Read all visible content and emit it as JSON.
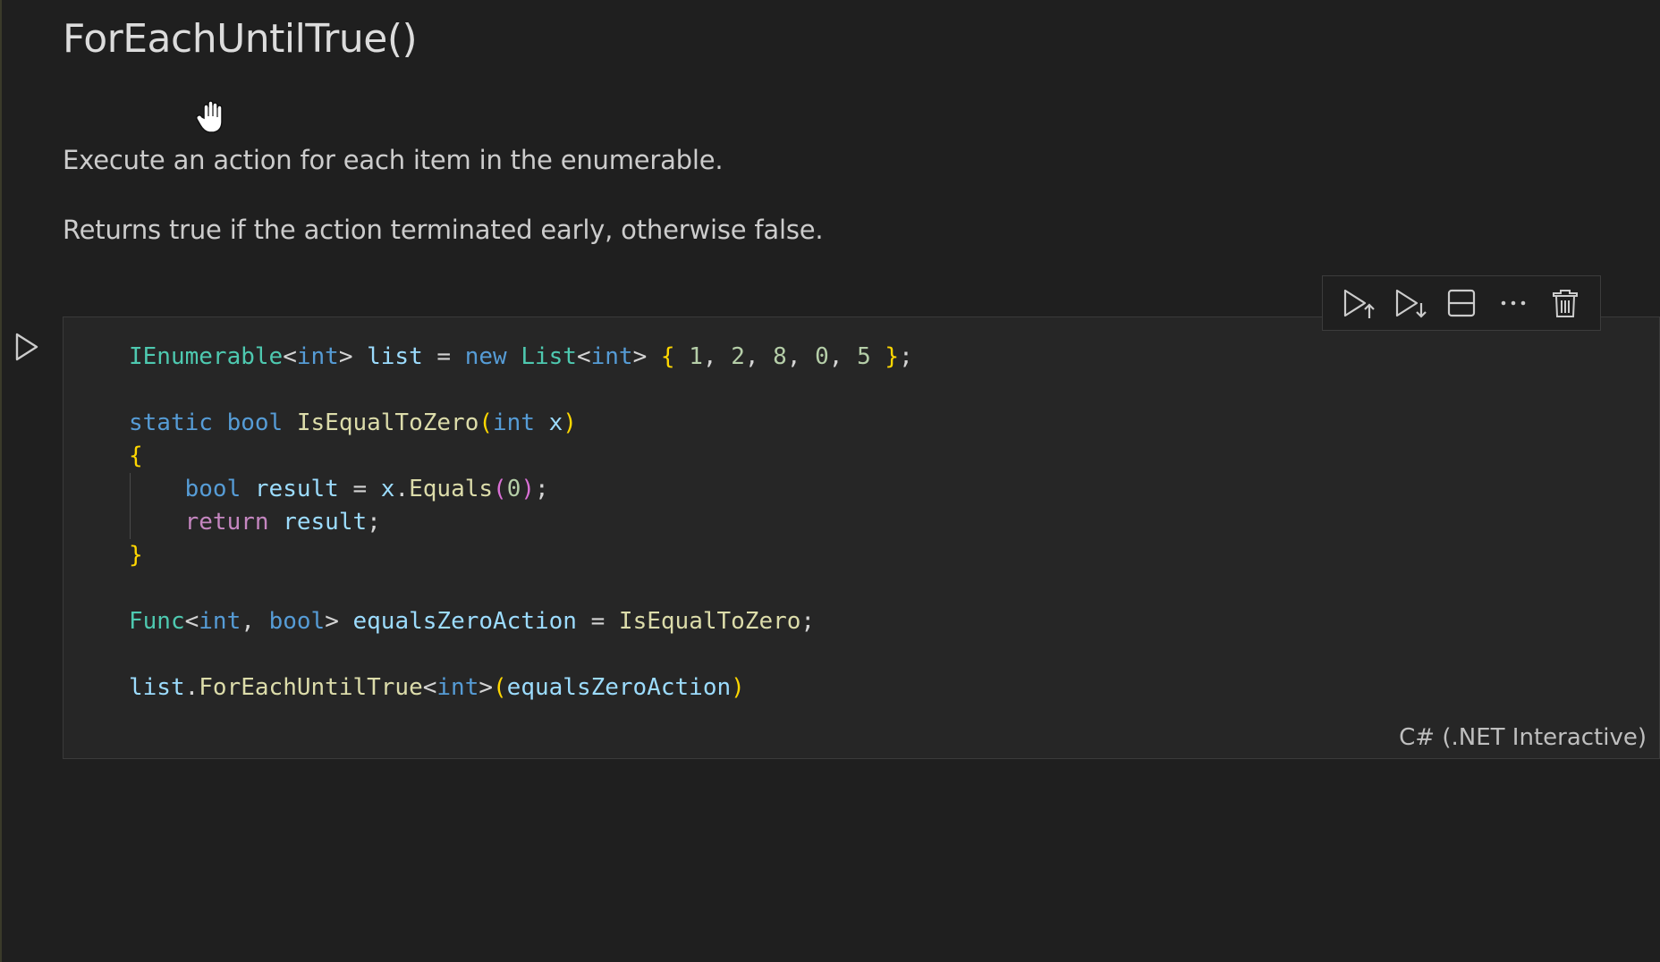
{
  "markdown": {
    "heading": "ForEachUntilTrue()",
    "paragraph1": "Execute an action for each item in the enumerable.",
    "paragraph2": "Returns true if the action terminated early, otherwise false."
  },
  "cell": {
    "language": "C# (.NET Interactive)",
    "code_lines": [
      "IEnumerable<int> list = new List<int> { 1, 2, 8, 0, 5 };",
      "",
      "static bool IsEqualToZero(int x)",
      "{",
      "    bool result = x.Equals(0);",
      "    return result;",
      "}",
      "",
      "Func<int, bool> equalsZeroAction = IsEqualToZero;",
      "",
      "list.ForEachUntilTrue<int>(equalsZeroAction)"
    ]
  },
  "toolbar": {
    "icons": [
      "execute-above-icon",
      "execute-below-icon",
      "split-cell-icon",
      "more-actions-icon",
      "delete-cell-icon"
    ]
  },
  "icons": {
    "run_cell": "play-icon",
    "cursor": "hand-cursor-icon"
  }
}
